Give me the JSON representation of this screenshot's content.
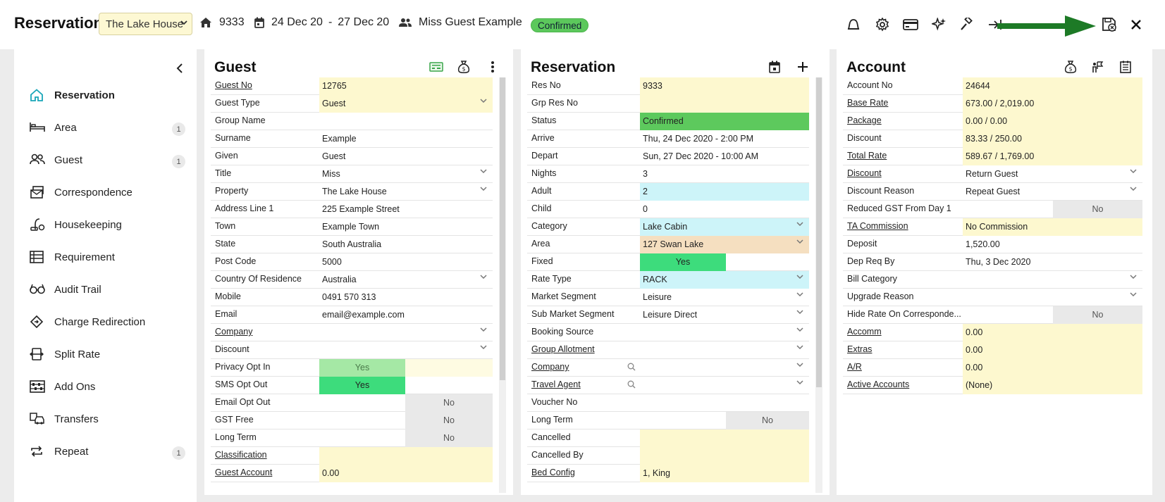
{
  "header": {
    "title": "Reservation",
    "property": "The Lake House",
    "res_no": "9333",
    "date_from": "24 Dec 20",
    "date_sep": "-",
    "date_to": "27 Dec 20",
    "guest_name": "Miss Guest Example",
    "status": "Confirmed",
    "status_color": "#5cc85c"
  },
  "sidebar": {
    "items": [
      {
        "label": "Reservation",
        "icon": "home-icon",
        "count": ""
      },
      {
        "label": "Area",
        "icon": "bed-icon",
        "count": "1"
      },
      {
        "label": "Guest",
        "icon": "users-icon",
        "count": "1"
      },
      {
        "label": "Correspondence",
        "icon": "mail-stack-icon",
        "count": ""
      },
      {
        "label": "Housekeeping",
        "icon": "vacuum-icon",
        "count": ""
      },
      {
        "label": "Requirement",
        "icon": "list-icon",
        "count": ""
      },
      {
        "label": "Audit Trail",
        "icon": "glasses-icon",
        "count": ""
      },
      {
        "label": "Charge Redirection",
        "icon": "diamond-arrow-icon",
        "count": ""
      },
      {
        "label": "Split Rate",
        "icon": "split-icon",
        "count": ""
      },
      {
        "label": "Add Ons",
        "icon": "abacus-icon",
        "count": ""
      },
      {
        "label": "Transfers",
        "icon": "car-icon",
        "count": ""
      },
      {
        "label": "Repeat",
        "icon": "repeat-icon",
        "count": "1"
      }
    ]
  },
  "guest": {
    "title": "Guest",
    "rows": [
      {
        "label": "Guest No",
        "value": "12765"
      },
      {
        "label": "Guest Type",
        "value": "Guest"
      },
      {
        "label": "Group Name",
        "value": ""
      },
      {
        "label": "Surname",
        "value": "Example"
      },
      {
        "label": "Given",
        "value": "Guest"
      },
      {
        "label": "Title",
        "value": "Miss"
      },
      {
        "label": "Property",
        "value": "The Lake House"
      },
      {
        "label": "Address Line 1",
        "value": "225 Example Street"
      },
      {
        "label": "Town",
        "value": "Example Town"
      },
      {
        "label": "State",
        "value": "South Australia"
      },
      {
        "label": "Post Code",
        "value": "5000"
      },
      {
        "label": "Country Of Residence",
        "value": "Australia"
      },
      {
        "label": "Mobile",
        "value": "0491 570 313"
      },
      {
        "label": "Email",
        "value": "email@example.com"
      },
      {
        "label": "Company",
        "value": ""
      },
      {
        "label": "Discount",
        "value": ""
      },
      {
        "label": "Privacy Opt In",
        "value": "Yes"
      },
      {
        "label": "SMS Opt Out",
        "value": "Yes"
      },
      {
        "label": "Email Opt Out",
        "value": "No"
      },
      {
        "label": "GST Free",
        "value": "No"
      },
      {
        "label": "Long Term",
        "value": "No"
      },
      {
        "label": "Classification",
        "value": ""
      },
      {
        "label": "Guest Account",
        "value": "0.00"
      }
    ]
  },
  "reservation": {
    "title": "Reservation",
    "rows": [
      {
        "label": "Res No",
        "value": "9333"
      },
      {
        "label": "Grp Res No",
        "value": ""
      },
      {
        "label": "Status",
        "value": "Confirmed"
      },
      {
        "label": "Arrive",
        "value": "Thu, 24 Dec 2020 - 2:00 PM"
      },
      {
        "label": "Depart",
        "value": "Sun, 27 Dec 2020 - 10:00 AM"
      },
      {
        "label": "Nights",
        "value": "3"
      },
      {
        "label": "Adult",
        "value": "2"
      },
      {
        "label": "Child",
        "value": "0"
      },
      {
        "label": "Category",
        "value": "Lake Cabin"
      },
      {
        "label": "Area",
        "value": "127 Swan Lake"
      },
      {
        "label": "Fixed",
        "value": "Yes"
      },
      {
        "label": "Rate Type",
        "value": "RACK"
      },
      {
        "label": "Market Segment",
        "value": "Leisure"
      },
      {
        "label": "Sub Market Segment",
        "value": "Leisure Direct"
      },
      {
        "label": "Booking Source",
        "value": ""
      },
      {
        "label": "Group Allotment",
        "value": ""
      },
      {
        "label": "Company",
        "value": ""
      },
      {
        "label": "Travel Agent",
        "value": ""
      },
      {
        "label": "Voucher No",
        "value": ""
      },
      {
        "label": "Long Term",
        "value": "No"
      },
      {
        "label": "Cancelled",
        "value": ""
      },
      {
        "label": "Cancelled By",
        "value": ""
      },
      {
        "label": "Bed Config",
        "value": "1, King"
      }
    ]
  },
  "account": {
    "title": "Account",
    "rows": [
      {
        "label": "Account No",
        "value": "24644"
      },
      {
        "label": "Base Rate",
        "value": "673.00 / 2,019.00"
      },
      {
        "label": "Package",
        "value": "0.00 / 0.00"
      },
      {
        "label": "Discount",
        "value": "83.33 / 250.00"
      },
      {
        "label": "Total Rate",
        "value": "589.67 / 1,769.00"
      },
      {
        "label": "Discount",
        "value": "Return Guest"
      },
      {
        "label": "Discount Reason",
        "value": "Repeat Guest"
      },
      {
        "label": "Reduced GST From Day 1",
        "value": "No"
      },
      {
        "label": "TA Commission",
        "value": "No Commission"
      },
      {
        "label": "Deposit",
        "value": "1,520.00"
      },
      {
        "label": "Dep Req By",
        "value": "Thu, 3 Dec 2020"
      },
      {
        "label": "Bill Category",
        "value": ""
      },
      {
        "label": "Upgrade Reason",
        "value": ""
      },
      {
        "label": "Hide Rate On Corresponde...",
        "value": "No"
      },
      {
        "label": "Accomm",
        "value": "0.00"
      },
      {
        "label": "Extras",
        "value": "0.00"
      },
      {
        "label": "A/R",
        "value": "0.00"
      },
      {
        "label": "Active Accounts",
        "value": "(None)"
      }
    ]
  }
}
